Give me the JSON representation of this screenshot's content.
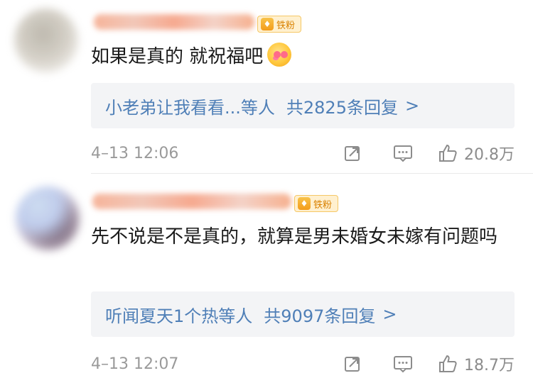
{
  "comments": [
    {
      "badge": "铁粉",
      "text": "如果是真的 就祝福吧",
      "replies": {
        "preview": "小老弟让我看看...等人",
        "total": "共2825条回复",
        "chevron": ">"
      },
      "timestamp": "4–13 12:06",
      "likes": "20.8万"
    },
    {
      "badge": "铁粉",
      "text": "先不说是不是真的，就算是男未婚女未嫁有问题吗",
      "replies": {
        "preview": "听闻夏天1个热等人",
        "total": "共9097条回复",
        "chevron": ">"
      },
      "timestamp": "4–13 12:07",
      "likes": "18.7万"
    }
  ],
  "icons": {
    "share": "share-icon",
    "comment": "comment-icon",
    "like": "thumb-up-icon",
    "emoji": "blush-emoji-icon",
    "badge": "fan-badge-icon"
  },
  "colors": {
    "link": "#4f7fb7",
    "muted": "#9a9a9a",
    "reply_bg": "#f3f4f6",
    "badge_bg": "#fff0cf"
  }
}
